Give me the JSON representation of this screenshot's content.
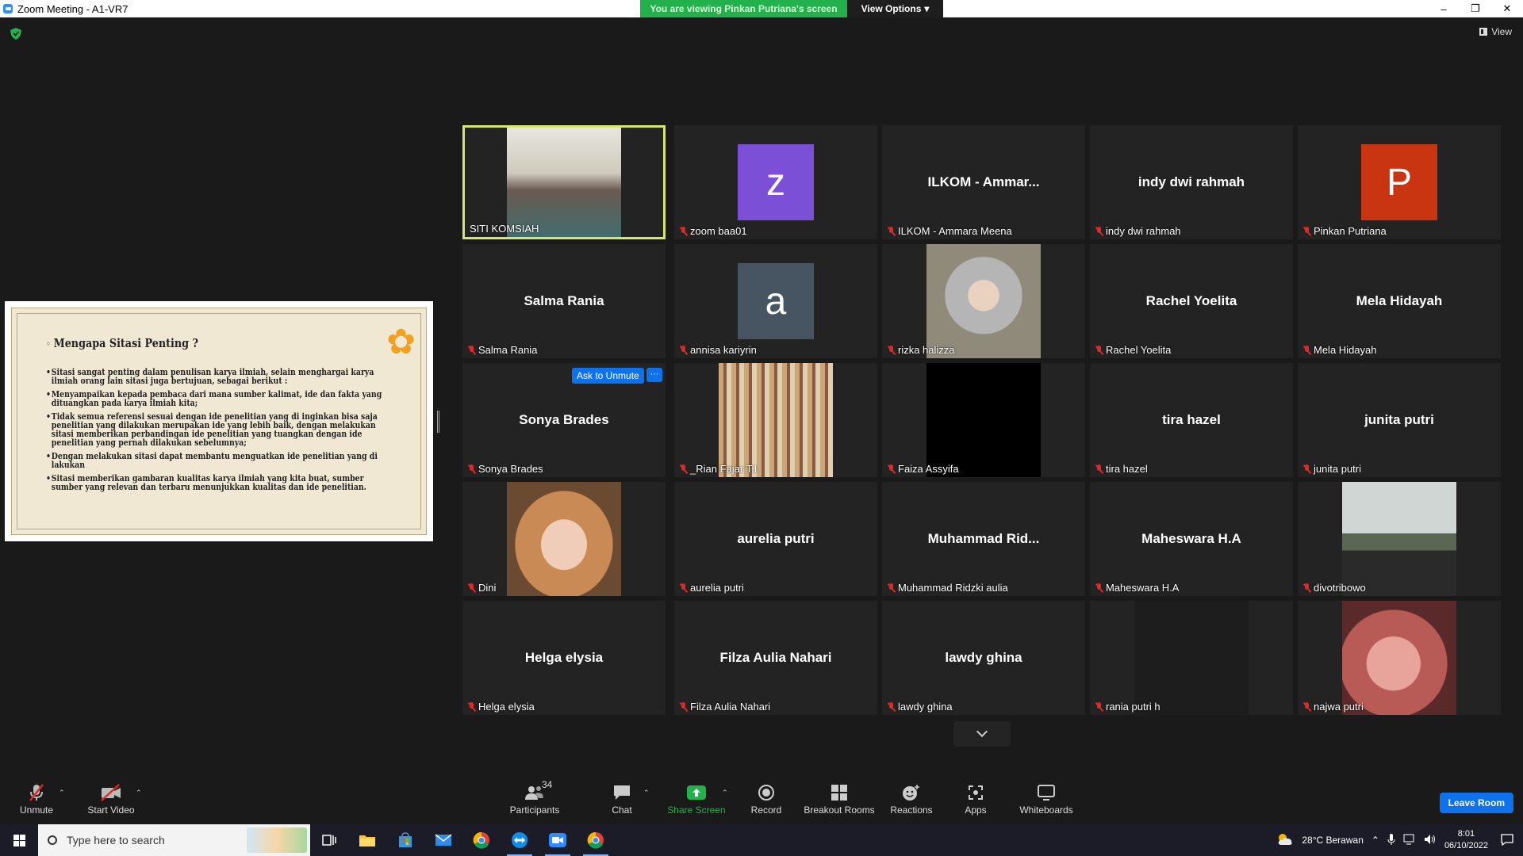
{
  "window": {
    "title": "Zoom Meeting - A1-VR7"
  },
  "share_banner": {
    "viewing": "You are viewing Pinkan Putriana's screen",
    "view_options": "View Options"
  },
  "view_button": "View",
  "slide": {
    "title": "Mengapa Sitasi Penting ?",
    "bullets": [
      "Sitasi sangat penting dalam penulisan karya ilmiah, selain menghargai karya ilmiah orang lain sitasi juga bertujuan, sebagai berikut :",
      "Menyampaikan kepada pembaca dari mana sumber kalimat, ide dan fakta yang dituangkan pada karya ilmiah kita;",
      "Tidak semua referensi sesuai dengan ide penelitian yang di inginkan bisa saja penelitian yang dilakukan merupakan ide yang lebih baik, dengan melakukan sitasi memberikan perbandingan ide penelitian yang tuangkan dengan ide penelitian yang pernah dilakukan sebelumnya;",
      "Dengan melakukan sitasi dapat membantu menguatkan ide penelitian yang di lakukan",
      "Sitasi memberikan gambaran kualitas karya ilmiah yang kita buat, sumber sumber yang relevan dan terbaru menunjukkan kualitas dan ide penelitian."
    ]
  },
  "participants": [
    {
      "label": "SITI KOMSIAH",
      "center": "",
      "avatar": "",
      "photo": "video",
      "muted": false
    },
    {
      "label": "zoom baa01",
      "center": "",
      "avatar": "z",
      "avatar_color": "#7b4fd6",
      "muted": true
    },
    {
      "label": "ILKOM - Ammara Meena",
      "center": "ILKOM - Ammar...",
      "muted": true
    },
    {
      "label": "indy dwi rahmah",
      "center": "indy dwi rahmah",
      "muted": true
    },
    {
      "label": "Pinkan Putriana",
      "center": "",
      "avatar": "P",
      "avatar_color": "#c83510",
      "muted": true
    },
    {
      "label": "Salma Rania",
      "center": "Salma Rania",
      "muted": true
    },
    {
      "label": "annisa kariyrin",
      "center": "",
      "avatar": "a",
      "avatar_color": "#475461",
      "muted": true
    },
    {
      "label": "rizka halizza",
      "center": "",
      "photo": "hoodie",
      "muted": true
    },
    {
      "label": "Rachel Yoelita",
      "center": "Rachel Yoelita",
      "muted": true
    },
    {
      "label": "Mela Hidayah",
      "center": "Mela Hidayah",
      "muted": true
    },
    {
      "label": "Sonya Brades",
      "center": "Sonya Brades",
      "muted": true,
      "ask_unmute": "Ask to Unmute"
    },
    {
      "label": "_Rian Fajar T.I",
      "center": "",
      "photo": "library",
      "muted": true
    },
    {
      "label": "Faiza Assyifa",
      "center": "",
      "photo": "black",
      "muted": true
    },
    {
      "label": "tira hazel",
      "center": "tira hazel",
      "muted": true
    },
    {
      "label": "junita putri",
      "center": "junita putri",
      "muted": true
    },
    {
      "label": "Dini",
      "center": "",
      "photo": "portrait",
      "muted": true
    },
    {
      "label": "aurelia putri",
      "center": "aurelia putri",
      "muted": true
    },
    {
      "label": "Muhammad Ridzki aulia",
      "center": "Muhammad  Rid...",
      "muted": true
    },
    {
      "label": "Maheswara H.A",
      "center": "Maheswara H.A",
      "muted": true
    },
    {
      "label": "divotribowo",
      "center": "",
      "photo": "crosswalk",
      "muted": true
    },
    {
      "label": "Helga elysia",
      "center": "Helga elysia",
      "muted": true
    },
    {
      "label": "Filza Aulia Nahari",
      "center": "Filza Aulia Nahari",
      "muted": true
    },
    {
      "label": "lawdy ghina",
      "center": "lawdy ghina",
      "muted": true
    },
    {
      "label": "rania putri h",
      "center": "",
      "photo": "dark",
      "muted": true
    },
    {
      "label": "najwa putri",
      "center": "",
      "photo": "closeup",
      "muted": true
    }
  ],
  "toolbar": {
    "unmute": "Unmute",
    "start_video": "Start Video",
    "participants": "Participants",
    "participants_count": "34",
    "chat": "Chat",
    "share_screen": "Share Screen",
    "record": "Record",
    "breakout_rooms": "Breakout Rooms",
    "reactions": "Reactions",
    "apps": "Apps",
    "whiteboards": "Whiteboards",
    "leave_room": "Leave Room"
  },
  "taskbar": {
    "search_placeholder": "Type here to search",
    "weather": "28°C  Berawan",
    "time": "8:01",
    "date": "06/10/2022"
  },
  "colors": {
    "share_green": "#23b14d",
    "accent_blue": "#0e72ed",
    "active_speaker": "#d6e66a",
    "muted_red": "#e02828"
  }
}
